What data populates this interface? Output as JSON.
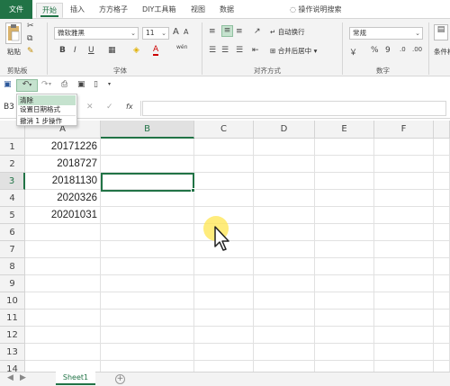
{
  "ribbon_tabs": {
    "file": "文件",
    "home": "开始",
    "insert": "插入",
    "fangfang": "方方格子",
    "diy": "DIY工具箱",
    "view": "视图",
    "data": "数据",
    "tell_me": "操作说明搜索"
  },
  "clipboard": {
    "paste": "粘贴",
    "label": "剪贴板"
  },
  "font": {
    "name": "微软雅黑",
    "size": "11",
    "bold": "B",
    "italic": "I",
    "underline": "U",
    "label": "字体",
    "wen": "wén",
    "font_color": "A"
  },
  "alignment": {
    "wrap_text": "自动换行",
    "merge_center": "合并后居中",
    "label": "对齐方式"
  },
  "number": {
    "format": "常规",
    "percent": "%",
    "comma": "9",
    "label": "数字"
  },
  "styles": {
    "conditional": "条件格"
  },
  "undo_dropdown": {
    "items": [
      "清除",
      "设置日期格式"
    ],
    "footer": "撤消 1 步操作"
  },
  "formula_bar": {
    "name_box": "B3",
    "fx": "fx",
    "cancel": "✕",
    "confirm": "✓"
  },
  "columns": [
    "A",
    "B",
    "C",
    "D",
    "E",
    "F"
  ],
  "rows": [
    "1",
    "2",
    "3",
    "4",
    "5",
    "6",
    "7",
    "8",
    "9",
    "10",
    "11",
    "12",
    "13",
    "14"
  ],
  "cells": {
    "A1": "20171226",
    "A2": "2018727",
    "A3": "20181130",
    "A4": "2020326",
    "A5": "20201031"
  },
  "sheets": {
    "active": "Sheet1",
    "add": "+"
  },
  "colors": {
    "accent": "#217346",
    "highlight": "#c5e2ce"
  }
}
